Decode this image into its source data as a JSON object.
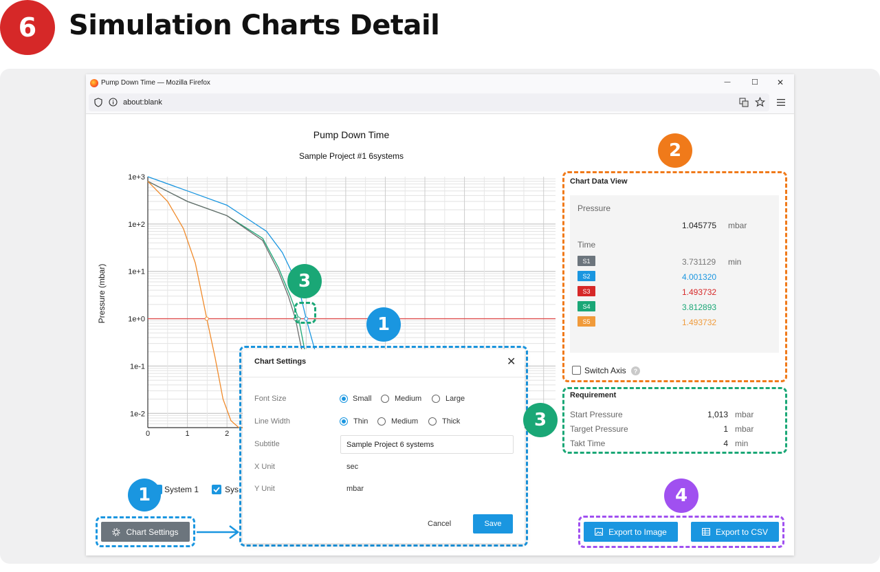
{
  "header": {
    "step_number": "6",
    "title": "Simulation Charts Detail"
  },
  "window": {
    "title": "Pump Down Time — Mozilla Firefox",
    "url": "about:blank",
    "minimize": "—",
    "maximize": "☐",
    "close": "✕"
  },
  "badges": {
    "settings_btn": "1",
    "settings_dialog": "1",
    "data_view": "2",
    "requirement": "3",
    "crosshair": "3",
    "export": "4"
  },
  "colors": {
    "blue_badge": "#1a96e0",
    "orange_badge": "#f07a1a",
    "green_badge": "#1aa776",
    "purple_badge": "#a050f0",
    "red_badge": "#d62828"
  },
  "chart_data": {
    "type": "line",
    "title": "Pump Down Time",
    "subtitle": "Sample Project #1 6systems",
    "ylabel": "Pressure (mbar)",
    "xlabel": "",
    "yscale": "log",
    "ylim": [
      0.005,
      1000
    ],
    "xlim": [
      0,
      10.3
    ],
    "y_tick_labels": [
      "1e+3",
      "1e+2",
      "1e+1",
      "1e+0",
      "1e-1",
      "1e-2"
    ],
    "x_tick_labels": [
      "0",
      "1",
      "2"
    ],
    "target_line": {
      "y": 1,
      "color": "#e05050"
    },
    "series": [
      {
        "color": "#1a96e0",
        "x": [
          0,
          1,
          2,
          3,
          3.4,
          3.8,
          4.0,
          4.2,
          4.5
        ],
        "y": [
          1000,
          500,
          250,
          70,
          25,
          5,
          1,
          0.25,
          0.03
        ]
      },
      {
        "color": "#1aa776",
        "x": [
          0,
          1,
          2,
          2.9,
          3.3,
          3.6,
          3.81,
          4.0,
          4.2
        ],
        "y": [
          800,
          300,
          150,
          50,
          12,
          3,
          1,
          0.15,
          0.02
        ]
      },
      {
        "color": "#6c6c6c",
        "x": [
          0,
          1,
          2,
          2.9,
          3.3,
          3.55,
          3.73,
          3.9,
          4.1
        ],
        "y": [
          800,
          300,
          150,
          45,
          10,
          3,
          1,
          0.2,
          0.02
        ]
      },
      {
        "color": "#f08a2a",
        "x": [
          0,
          0.5,
          0.9,
          1.2,
          1.49,
          1.7,
          1.9,
          2.1,
          2.3,
          2.6
        ],
        "y": [
          800,
          300,
          80,
          15,
          1,
          0.15,
          0.02,
          0.007,
          0.005,
          0.005
        ]
      }
    ]
  },
  "legend": {
    "system1": "System 1",
    "system2": "Sys"
  },
  "data_view": {
    "title": "Chart Data View",
    "pressure_label": "Pressure",
    "pressure_value": "1.045775",
    "pressure_unit": "mbar",
    "time_label": "Time",
    "time_unit": "min",
    "rows": [
      {
        "tag": "S1",
        "value": "3.731129",
        "color": "#6c757d"
      },
      {
        "tag": "S2",
        "value": "4.001320",
        "color": "#1a96e0"
      },
      {
        "tag": "S3",
        "value": "1.493732",
        "color": "#d62828"
      },
      {
        "tag": "S4",
        "value": "3.812893",
        "color": "#1aa776"
      },
      {
        "tag": "S5",
        "value": "1.493732",
        "color": "#f09a3a"
      }
    ],
    "switch_axis": "Switch Axis"
  },
  "requirement": {
    "title": "Requirement",
    "rows": [
      {
        "label": "Start Pressure",
        "value": "1,013",
        "unit": "mbar"
      },
      {
        "label": "Target Pressure",
        "value": "1",
        "unit": "mbar"
      },
      {
        "label": "Takt Time",
        "value": "4",
        "unit": "min"
      }
    ]
  },
  "settings_dialog": {
    "title": "Chart Settings",
    "font_size_label": "Font Size",
    "font_options": [
      "Small",
      "Medium",
      "Large"
    ],
    "line_width_label": "Line Width",
    "line_options": [
      "Thin",
      "Medium",
      "Thick"
    ],
    "subtitle_label": "Subtitle",
    "subtitle_value": "Sample Project 6 systems",
    "x_unit_label": "X Unit",
    "x_unit_value": "sec",
    "y_unit_label": "Y Unit",
    "y_unit_value": "mbar",
    "cancel": "Cancel",
    "save": "Save"
  },
  "buttons": {
    "chart_settings": "Chart Settings",
    "export_image": "Export to Image",
    "export_csv": "Export to CSV"
  }
}
